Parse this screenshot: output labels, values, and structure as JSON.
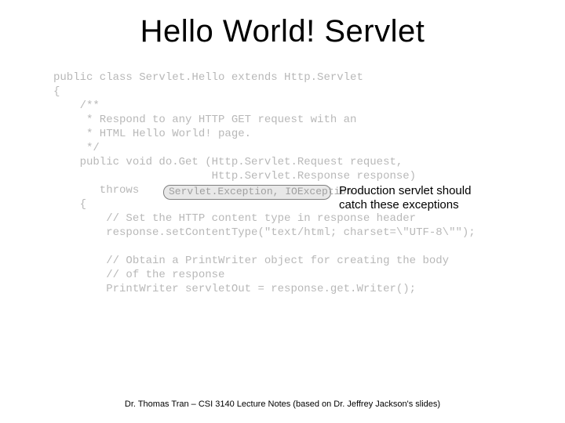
{
  "title": "Hello World! Servlet",
  "code": {
    "line1": "public class Servlet.Hello extends Http.Servlet",
    "line2": "{",
    "line3": "    /**",
    "line4": "     * Respond to any HTTP GET request with an",
    "line5": "     * HTML Hello World! page.",
    "line6": "     */",
    "line7": "    public void do.Get (Http.Servlet.Request request,",
    "line8": "                        Http.Servlet.Response response)",
    "line9_prefix": "       throws ",
    "line9_highlight": "Servlet.Exception, IOException",
    "line10": "    {",
    "line11": "        // Set the HTTP content type in response header",
    "line12": "        response.setContentType(\"text/html; charset=\\\"UTF-8\\\"\");",
    "line13": "",
    "line14": "        // Obtain a PrintWriter object for creating the body",
    "line15": "        // of the response",
    "line16": "        PrintWriter servletOut = response.get.Writer();"
  },
  "annotation": {
    "line1": "Production servlet should",
    "line2": "catch these exceptions"
  },
  "footer": "Dr. Thomas Tran – CSI 3140 Lecture Notes (based on Dr. Jeffrey Jackson's slides)"
}
